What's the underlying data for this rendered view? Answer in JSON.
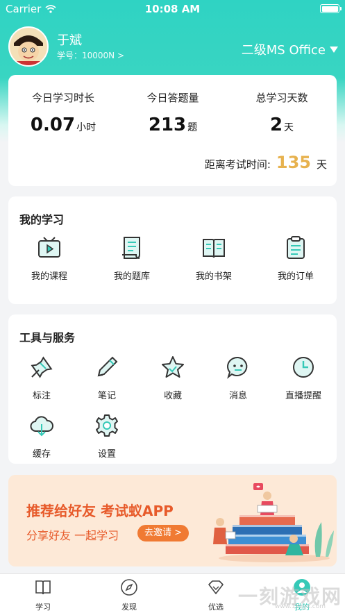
{
  "status_bar": {
    "carrier": "Carrier",
    "time": "10:08 AM"
  },
  "profile": {
    "name": "于斌",
    "student_id": "学号：10000N >",
    "exam": "二级MS Office"
  },
  "stats": {
    "study_time_label": "今日学习时长",
    "study_time_value": "0.07",
    "study_time_unit": "小时",
    "questions_label": "今日答题量",
    "questions_value": "213",
    "questions_unit": "题",
    "days_label": "总学习天数",
    "days_value": "2",
    "days_unit": "天",
    "countdown_label": "距离考试时间:",
    "countdown_value": "135",
    "countdown_unit": "天"
  },
  "my_study": {
    "title": "我的学习",
    "items": [
      {
        "label": "我的课程",
        "icon": "video-course-icon"
      },
      {
        "label": "我的题库",
        "icon": "question-bank-icon"
      },
      {
        "label": "我的书架",
        "icon": "bookshelf-icon"
      },
      {
        "label": "我的订单",
        "icon": "order-icon"
      }
    ]
  },
  "tools": {
    "title": "工具与服务",
    "items": [
      {
        "label": "标注",
        "icon": "pin-icon"
      },
      {
        "label": "笔记",
        "icon": "pencil-icon"
      },
      {
        "label": "收藏",
        "icon": "star-icon"
      },
      {
        "label": "消息",
        "icon": "message-icon"
      },
      {
        "label": "直播提醒",
        "icon": "clock-icon"
      },
      {
        "label": "缓存",
        "icon": "cloud-download-icon"
      },
      {
        "label": "设置",
        "icon": "gear-icon"
      }
    ]
  },
  "banner": {
    "title": "推荐给好友 考试蚁APP",
    "subtitle": "分享好友 一起学习",
    "invite_button": "去邀请 >"
  },
  "tab_bar": {
    "items": [
      {
        "label": "学习",
        "icon": "book-icon"
      },
      {
        "label": "发现",
        "icon": "compass-icon"
      },
      {
        "label": "优选",
        "icon": "diamond-icon"
      },
      {
        "label": "我的",
        "icon": "user-icon"
      }
    ],
    "active_index": 3
  },
  "watermark": {
    "text": "一刻游戏网",
    "sub": "www.1kxyx.com"
  },
  "colors": {
    "brand": "#35c9b7",
    "accent": "#e7b24f",
    "banner_text": "#e75a2a"
  }
}
